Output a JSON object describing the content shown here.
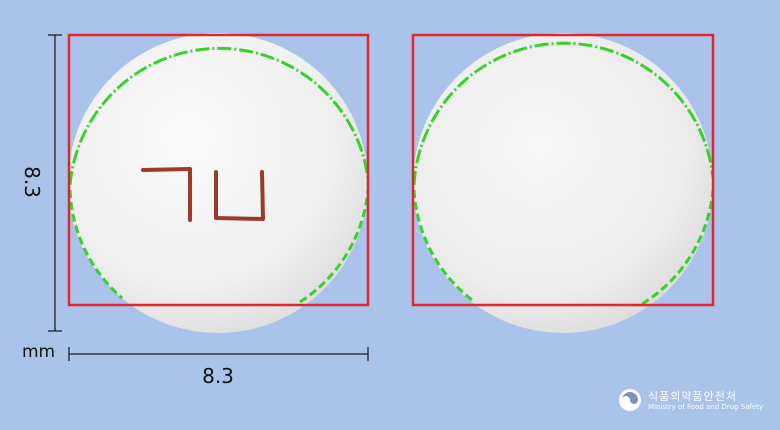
{
  "dimensions": {
    "height_value": "8.3",
    "width_value": "8.3",
    "unit": "mm"
  },
  "tablets": {
    "front_imprint": "ㄱU",
    "imprint_color": "#9c3b2a",
    "tablet_color": "#f2f2f2",
    "box_color": "#e3262b",
    "outline_color": "#38d12c"
  },
  "watermark": {
    "agency_korean": "식품의약품안전처",
    "agency_english": "Ministry of Food and Drug Safety"
  }
}
